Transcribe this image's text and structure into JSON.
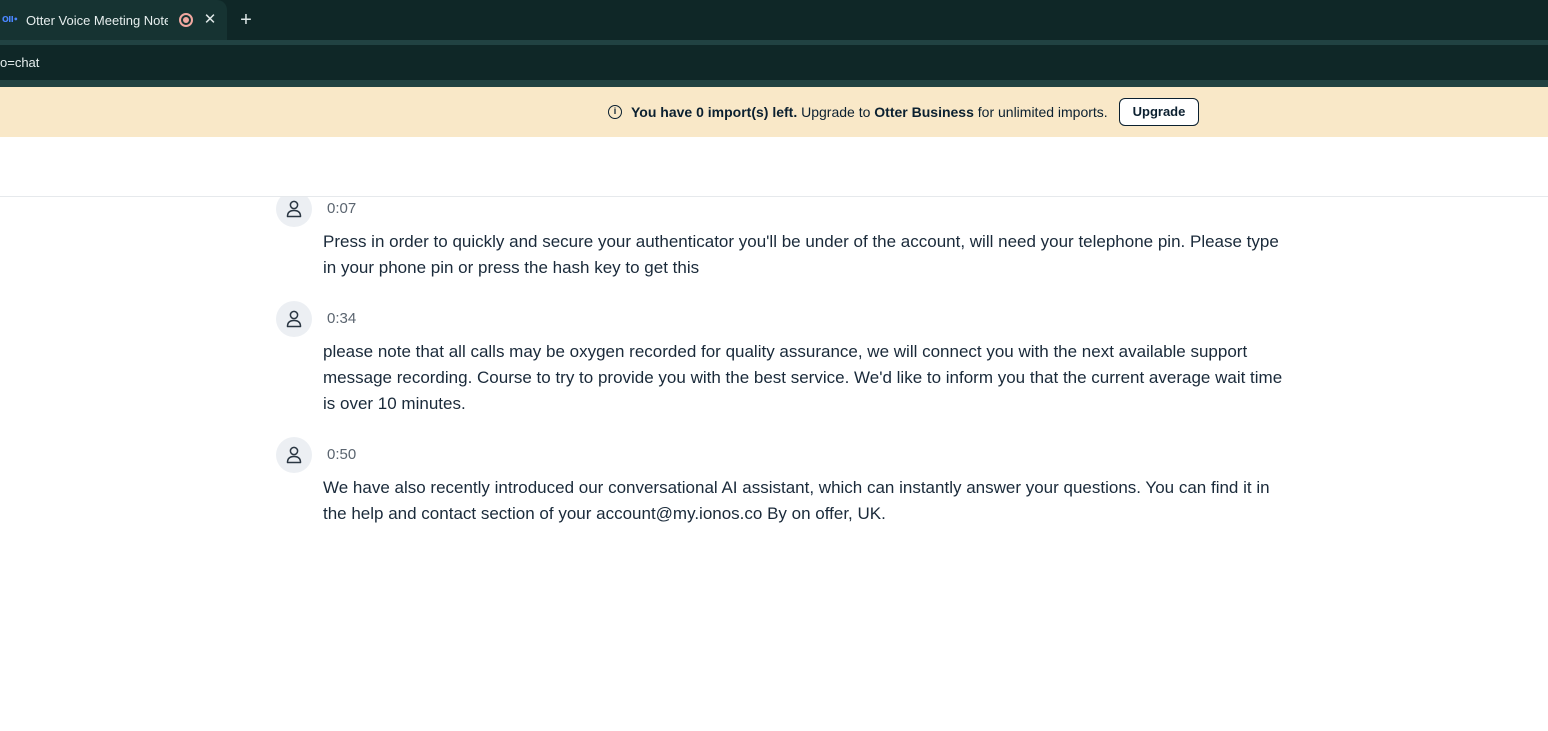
{
  "browser": {
    "tab_title": "Otter Voice Meeting Notes",
    "tab_icon": "otter-favicon",
    "favicon_text": "OII•",
    "close_glyph": "✕",
    "new_tab_glyph": "+",
    "address_text": "o=chat"
  },
  "banner": {
    "info_glyph": "i",
    "strong_prefix": "You have 0 import(s) left.",
    "mid_text": " Upgrade to ",
    "brand": "Otter Business",
    "suffix": " for unlimited imports.",
    "upgrade_label": "Upgrade"
  },
  "transcript": {
    "segments": [
      {
        "time": "0:07",
        "text": "Press in order to quickly and secure your authenticator you'll be under of the account, will need your telephone pin. Please  type in your phone pin or press the hash key to get this"
      },
      {
        "time": "0:34",
        "text": "please note that all calls may be oxygen recorded for quality assurance, we will connect you with the next available support message recording. Course to try to provide you with the best service. We'd like to inform you that the current average wait time is over 10 minutes."
      },
      {
        "time": "0:50",
        "text": "We have also recently introduced our conversational AI assistant, which can instantly answer your questions. You can find  it in the help and contact section of your account@my.ionos.co By on offer, UK."
      }
    ]
  },
  "colors": {
    "chrome_dark": "#0f2727",
    "banner_bg": "#f9e8c8",
    "text_primary": "#1a2a3a"
  }
}
